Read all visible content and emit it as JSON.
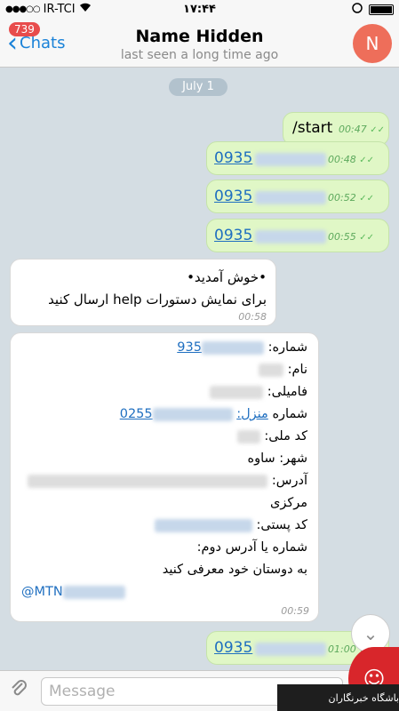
{
  "status_bar": {
    "carrier": "IR-TCI",
    "time": "۱۷:۴۴"
  },
  "nav": {
    "back_label": "Chats",
    "unread_badge": "739",
    "contact_name": "Name Hidden",
    "last_seen": "last seen a long time ago",
    "avatar_initial": "N"
  },
  "chat": {
    "date_divider": "July 1",
    "messages": [
      {
        "text": "/start",
        "time": "00:47"
      },
      {
        "text": "0935",
        "time": "00:48"
      },
      {
        "text": "0935",
        "time": "00:52"
      },
      {
        "text": "0935",
        "time": "00:55"
      },
      {
        "line1": "•خوش آمدید•",
        "line2": "برای نمایش دستورات help ارسال کنید",
        "time": "00:58"
      },
      {
        "shomare_label": "شماره:",
        "shomare_value": "935",
        "name_label": "نام:",
        "family_label": "فامیلی:",
        "home_label": "شماره",
        "home_link": "منزل:",
        "home_value": "0255",
        "national_id_label": "کد ملی:",
        "city": "شهر: ساوه",
        "address_label": "آدرس:",
        "markazi": "مرکزی",
        "postal_label": "کد پستی:",
        "second_address": "شماره یا آدرس دوم:",
        "invite": "به دوستان خود معرفی کنید",
        "mention": "@MTN",
        "time": "00:59"
      },
      {
        "text": "0935",
        "time": "01:00"
      }
    ]
  },
  "input": {
    "placeholder": "Message"
  },
  "watermark": {
    "text": "باشگاه خبرنگاران"
  },
  "colors": {
    "accent": "#1a82d8",
    "outgoing_bubble": "#e0f7c6",
    "badge": "#e84c4c",
    "avatar": "#ee6e5a"
  }
}
